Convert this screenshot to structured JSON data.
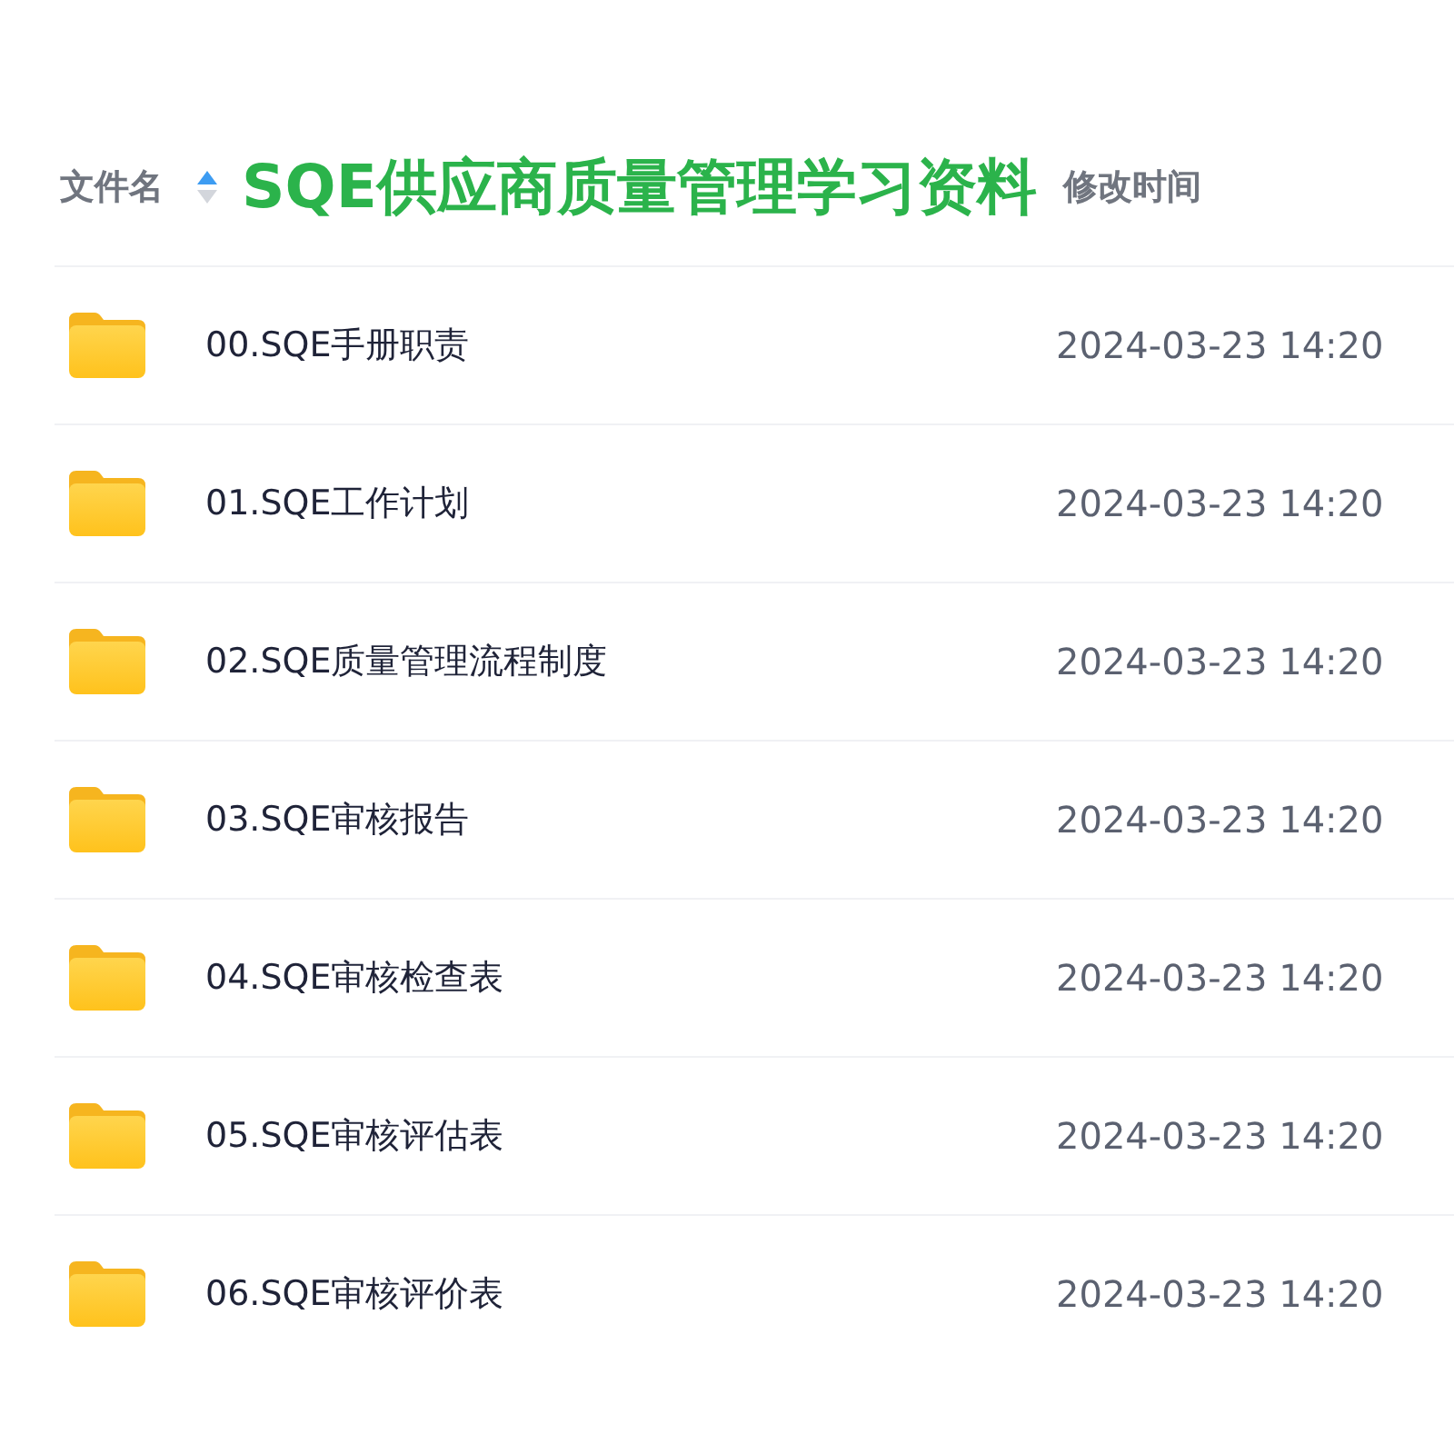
{
  "header": {
    "name_label": "文件名",
    "sort_ascending": true,
    "title": "SQE供应商质量管理学习资料",
    "time_label": "修改时间"
  },
  "files": [
    {
      "name": "00.SQE手册职责",
      "modified": "2024-03-23 14:20"
    },
    {
      "name": "01.SQE工作计划",
      "modified": "2024-03-23 14:20"
    },
    {
      "name": "02.SQE质量管理流程制度",
      "modified": "2024-03-23 14:20"
    },
    {
      "name": "03.SQE审核报告",
      "modified": "2024-03-23 14:20"
    },
    {
      "name": "04.SQE审核检查表",
      "modified": "2024-03-23 14:20"
    },
    {
      "name": "05.SQE审核评估表",
      "modified": "2024-03-23 14:20"
    },
    {
      "name": "06.SQE审核评价表",
      "modified": "2024-03-23 14:20"
    }
  ]
}
